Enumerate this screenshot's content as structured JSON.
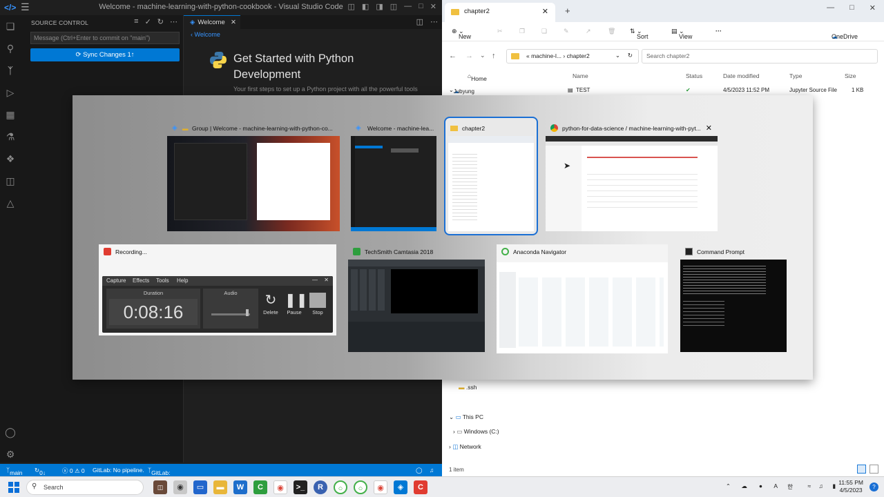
{
  "vscode": {
    "window_title": "Welcome - machine-learning-with-python-cookbook - Visual Studio Code",
    "sidebar": {
      "header": "SOURCE CONTROL",
      "commit_placeholder": "Message (Ctrl+Enter to commit on \"main\")",
      "sync_button": "⟳ Sync Changes 1↑"
    },
    "tab_label": "Welcome",
    "breadcrumb": "Welcome",
    "welcome": {
      "title": "Get Started with Python Development",
      "subtitle": "Your first steps to set up a Python project with all the powerful tools"
    },
    "status": {
      "branch": "main",
      "sync": "0↓ 1↑",
      "problems": "ⓧ 0 ⚠ 0",
      "gitlab_pipeline": "GitLab: No pipeline.",
      "gitlab_mr": "GitLab: Create MR."
    }
  },
  "explorer": {
    "tab_title": "chapter2",
    "commands": {
      "new": "New",
      "sort": "Sort",
      "view": "View",
      "more": "···",
      "onedrive": "OneDrive"
    },
    "address": {
      "parent": "machine-l...",
      "current": "chapter2"
    },
    "search_placeholder": "Search chapter2",
    "columns": [
      "Name",
      "Status",
      "Date modified",
      "Type",
      "Size"
    ],
    "nav": {
      "home": "Home",
      "personal": "Jubyung - Personal",
      "ssh": ".ssh",
      "this_pc": "This PC",
      "windows_c": "Windows (C:)",
      "network": "Network"
    },
    "row": {
      "name": "TEST",
      "date": "4/5/2023 11:52 PM",
      "type": "Jupyter Source File",
      "size": "1 KB"
    },
    "status_text": "1 item"
  },
  "switcher": {
    "row1": [
      {
        "title": "Group | Welcome - machine-learning-with-python-co...",
        "icon": "vscode-icon"
      },
      {
        "title": "Welcome - machine-lea...",
        "icon": "vscode-icon"
      },
      {
        "title": "chapter2",
        "icon": "folder-icon"
      },
      {
        "title": "python-for-data-science / machine-learning-with-pyt...",
        "icon": "chrome-icon"
      }
    ],
    "row2": [
      {
        "title": "Recording...",
        "icon": "camtasia-icon"
      },
      {
        "title": "TechSmith Camtasia 2018",
        "icon": "camtasia-icon"
      },
      {
        "title": "Anaconda Navigator",
        "icon": "anaconda-icon"
      },
      {
        "title": "Command Prompt",
        "icon": "cmd-icon"
      }
    ],
    "recorder": {
      "menu": [
        "Capture",
        "Effects",
        "Tools",
        "Help"
      ],
      "duration_label": "Duration",
      "duration": "0:08:16",
      "audio_label": "Audio",
      "delete": "Delete",
      "pause": "Pause",
      "stop": "Stop"
    }
  },
  "taskbar": {
    "search": "Search",
    "time": "11:55 PM",
    "date": "4/5/2023"
  },
  "colors": {
    "accent": "#0078d4",
    "selection": "#1a6fd4",
    "vscode_bg": "#1f1f1f"
  }
}
